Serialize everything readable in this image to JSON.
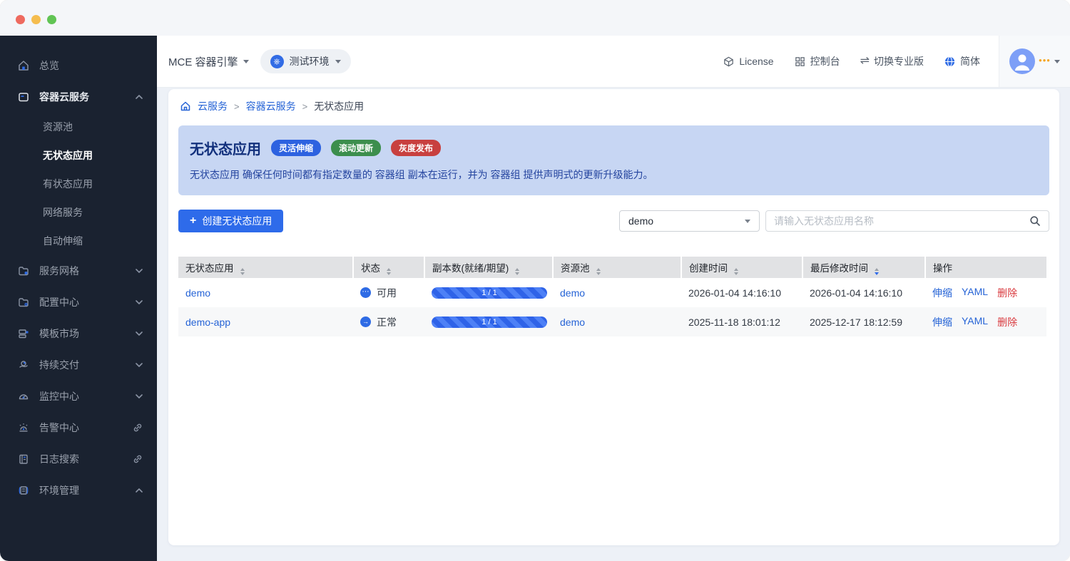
{
  "window": {
    "controls": [
      "close",
      "minimize",
      "zoom"
    ]
  },
  "header": {
    "product_name": "MCE 容器引擎",
    "environment": "测试环境",
    "nav": [
      {
        "label": "License",
        "icon": "license-icon"
      },
      {
        "label": "控制台",
        "icon": "console-icon"
      },
      {
        "label": "切换专业版",
        "icon": "switch-icon"
      },
      {
        "label": "简体",
        "icon": "globe-icon"
      }
    ]
  },
  "sidebar": {
    "items": [
      {
        "label": "总览",
        "icon": "home-icon"
      },
      {
        "label": "容器云服务",
        "icon": "container-service-icon",
        "expanded": true,
        "children": [
          {
            "label": "资源池"
          },
          {
            "label": "无状态应用",
            "active": true
          },
          {
            "label": "有状态应用"
          },
          {
            "label": "网络服务"
          },
          {
            "label": "自动伸缩"
          }
        ]
      },
      {
        "label": "服务网格",
        "icon": "service-mesh-icon"
      },
      {
        "label": "配置中心",
        "icon": "config-center-icon"
      },
      {
        "label": "模板市场",
        "icon": "template-market-icon"
      },
      {
        "label": "持续交付",
        "icon": "continuous-delivery-icon"
      },
      {
        "label": "监控中心",
        "icon": "monitor-center-icon"
      },
      {
        "label": "告警中心",
        "icon": "alert-center-icon",
        "external": true
      },
      {
        "label": "日志搜索",
        "icon": "log-search-icon",
        "external": true
      },
      {
        "label": "环境管理",
        "icon": "env-management-icon",
        "expanded": true
      }
    ]
  },
  "breadcrumb": {
    "separator": ">",
    "items": [
      "云服务",
      "容器云服务",
      "无状态应用"
    ]
  },
  "banner": {
    "title": "无状态应用",
    "badges": [
      {
        "label": "灵活伸缩",
        "color": "#2d62e0"
      },
      {
        "label": "滚动更新",
        "color": "#3c8e4d"
      },
      {
        "label": "灰度发布",
        "color": "#c8403f"
      }
    ],
    "description": "无状态应用 确保任何时间都有指定数量的 容器组 副本在运行，并为 容器组 提供声明式的更新升级能力。"
  },
  "toolbar": {
    "create_button": "创建无状态应用",
    "filter_selected": "demo",
    "search_placeholder": "请输入无状态应用名称"
  },
  "table": {
    "columns": [
      {
        "label": "无状态应用",
        "sortable": true
      },
      {
        "label": "状态",
        "sortable": true
      },
      {
        "label": "副本数(就绪/期望)",
        "sortable": true
      },
      {
        "label": "资源池",
        "sortable": true
      },
      {
        "label": "创建时间",
        "sortable": true
      },
      {
        "label": "最后修改时间",
        "sortable": true,
        "sorted": "desc"
      },
      {
        "label": "操作",
        "sortable": false
      }
    ],
    "action_labels": [
      "伸缩",
      "YAML",
      "删除"
    ],
    "rows": [
      {
        "name": "demo",
        "status": "可用",
        "status_icon": "ellipsis-circle-icon",
        "replicas": "1 / 1",
        "pool": "demo",
        "created": "2026-01-04 14:16:10",
        "modified": "2026-01-04 14:16:10"
      },
      {
        "name": "demo-app",
        "status": "正常",
        "status_icon": "arrow-circle-icon",
        "replicas": "1 / 1",
        "pool": "demo",
        "created": "2025-11-18 18:01:12",
        "modified": "2025-12-17 18:12:59"
      }
    ]
  },
  "colors": {
    "accent_blue": "#2e6bea",
    "link_blue": "#2563d6",
    "danger_red": "#d93a3f",
    "banner_bg": "#c7d6f3",
    "banner_text": "#24449f",
    "sidebar_bg": "#1a2230",
    "badge_blue": "#2d62e0",
    "badge_green": "#3c8e4d",
    "badge_red": "#c8403f",
    "k8s_blue": "#326ce5"
  }
}
